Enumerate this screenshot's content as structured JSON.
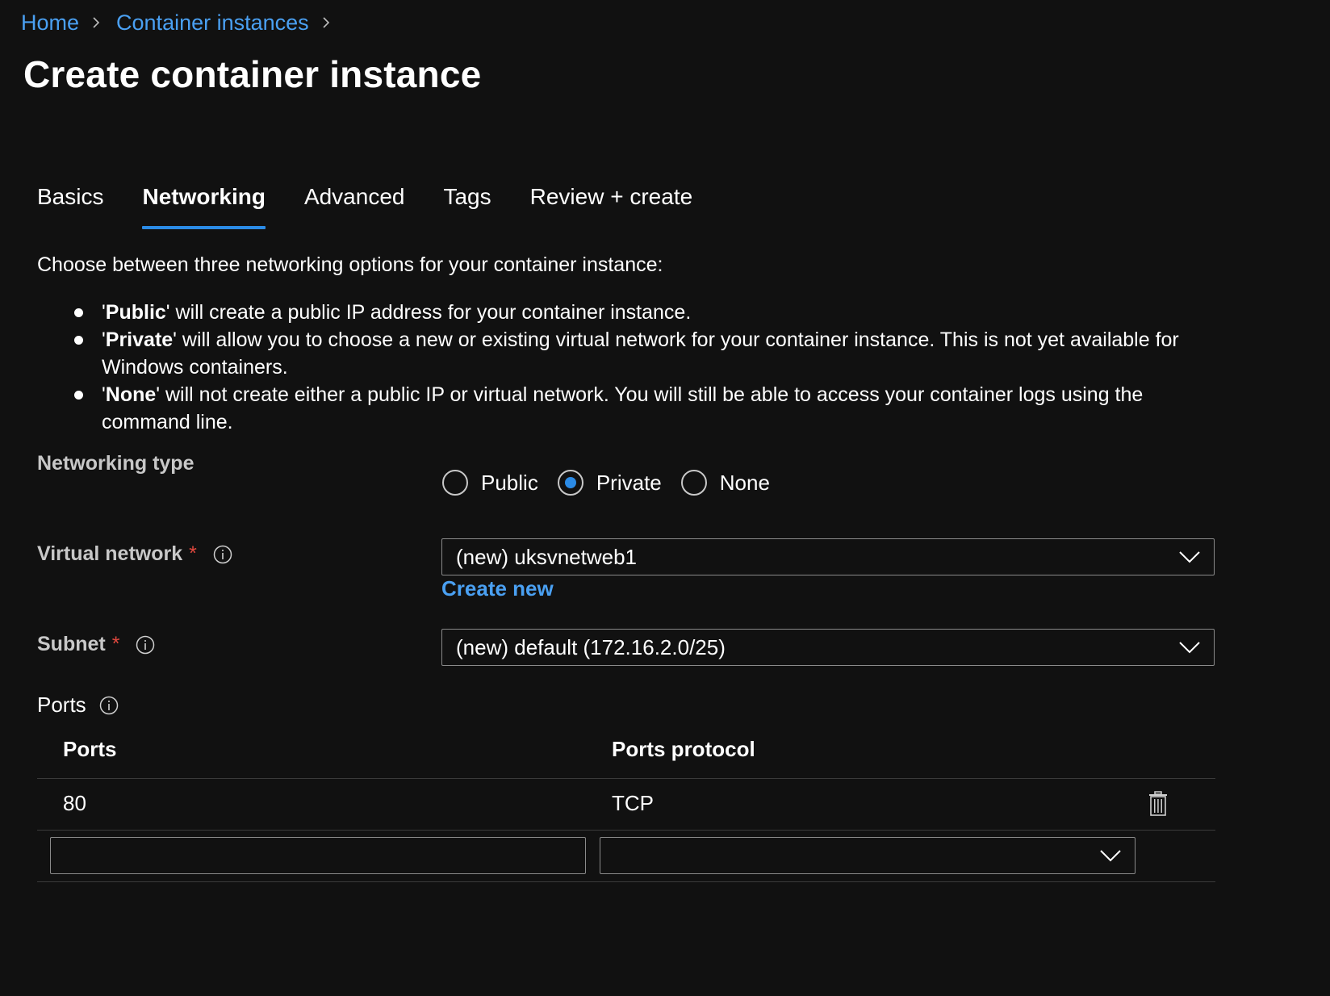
{
  "breadcrumb": {
    "home": "Home",
    "container_instances": "Container instances"
  },
  "page_title": "Create container instance",
  "tabs": [
    {
      "label": "Basics",
      "active": false
    },
    {
      "label": "Networking",
      "active": true
    },
    {
      "label": "Advanced",
      "active": false
    },
    {
      "label": "Tags",
      "active": false
    },
    {
      "label": "Review + create",
      "active": false
    }
  ],
  "intro": "Choose between three networking options for your container instance:",
  "bullets": [
    {
      "bold": "Public",
      "prefix": "'",
      "suffix": "' will create a public IP address for your container instance."
    },
    {
      "bold": "Private",
      "prefix": "'",
      "suffix": "' will allow you to choose a new or existing virtual network for your container instance. This is not yet available for Windows containers."
    },
    {
      "bold": "None",
      "prefix": "'",
      "suffix": "' will not create either a public IP or virtual network. You will still be able to access your container logs using the command line."
    }
  ],
  "networking_type": {
    "label": "Networking type",
    "options": [
      "Public",
      "Private",
      "None"
    ],
    "selected": "Private"
  },
  "virtual_network": {
    "label": "Virtual network",
    "required_mark": "*",
    "value": "(new) uksvnetweb1",
    "create_new": "Create new"
  },
  "subnet": {
    "label": "Subnet",
    "required_mark": "*",
    "value": "(new) default (172.16.2.0/25)"
  },
  "ports": {
    "label": "Ports",
    "columns": [
      "Ports",
      "Ports protocol"
    ],
    "rows": [
      {
        "port": "80",
        "protocol": "TCP"
      }
    ],
    "new_row": {
      "port": "",
      "protocol": ""
    }
  },
  "colors": {
    "background": "#111111",
    "accent": "#2b8be6",
    "link": "#4aa0f2",
    "required": "#e0483e"
  },
  "icons": {
    "breadcrumb_separator": "chevron-right-icon",
    "info": "info-icon",
    "dropdown": "chevron-down-icon",
    "delete": "trash-icon"
  }
}
